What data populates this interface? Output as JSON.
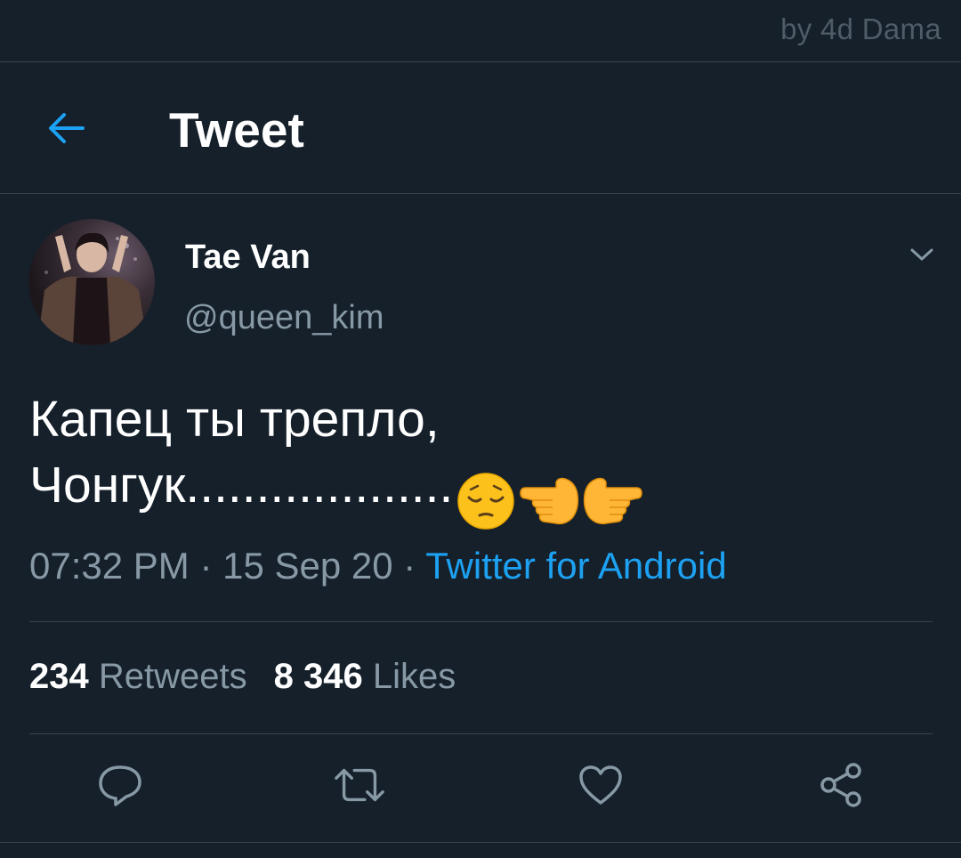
{
  "watermark": "by 4d Dama",
  "header": {
    "title": "Tweet"
  },
  "author": {
    "name": "Tae Van",
    "handle": "@queen_kim"
  },
  "tweet": {
    "text_line1": "Капец ты трепло,",
    "text_line2": "Чонгук...................",
    "emojis": [
      "pensive-face",
      "backhand-index-pointing-left",
      "backhand-index-pointing-right"
    ]
  },
  "meta": {
    "time": "07:32 PM",
    "sep1": " · ",
    "date": "15 Sep 20",
    "sep2": " · ",
    "source": "Twitter for Android"
  },
  "stats": {
    "retweets_count": "234",
    "retweets_label": "Retweets",
    "likes_count": "8 346",
    "likes_label": "Likes"
  },
  "actions": [
    "reply-icon",
    "retweet-icon",
    "like-icon",
    "share-icon"
  ],
  "colors": {
    "background": "#15202b",
    "divider": "#38444d",
    "secondary_text": "#8899a6",
    "accent": "#1da1f2"
  }
}
